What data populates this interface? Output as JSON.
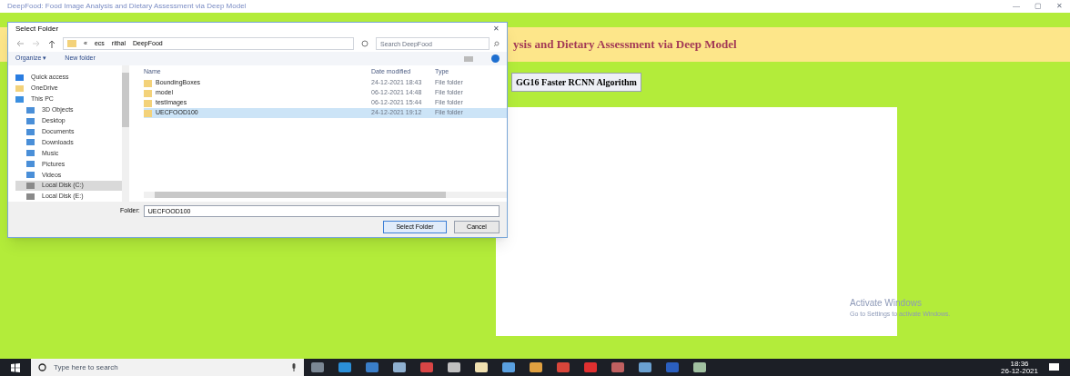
{
  "window": {
    "title": "DeepFood: Food Image Analysis and Dietary Assessment via Deep Model",
    "controls": [
      "—",
      "▢",
      "✕"
    ]
  },
  "app": {
    "heading": "ysis and Dietary Assessment via Deep Model",
    "button": "GG16 Faster RCNN Algorithm"
  },
  "dialog": {
    "title": "Select Folder",
    "close": "✕",
    "path": [
      "«",
      "ecs",
      "rithal",
      "DeepFood"
    ],
    "search": {
      "placeholder": "Search DeepFood"
    },
    "toolbar": [
      "Organize ▾",
      "New folder"
    ],
    "sidebar": [
      {
        "label": "Quick access",
        "selected": false
      },
      {
        "label": "OneDrive",
        "selected": false
      },
      {
        "label": "This PC",
        "selected": false,
        "children": [
          {
            "label": "3D Objects",
            "selected": false
          },
          {
            "label": "Desktop",
            "selected": false
          },
          {
            "label": "Documents",
            "selected": false
          },
          {
            "label": "Downloads",
            "selected": false
          },
          {
            "label": "Music",
            "selected": false
          },
          {
            "label": "Pictures",
            "selected": false
          },
          {
            "label": "Videos",
            "selected": false
          },
          {
            "label": "Local Disk (C:)",
            "selected": true
          },
          {
            "label": "Local Disk (E:)",
            "selected": false
          }
        ]
      }
    ],
    "columns": [
      "Name",
      "Date modified",
      "Type"
    ],
    "rows": [
      {
        "name": "BoundingBoxes",
        "date": "24-12-2021 18:43",
        "type": "File folder",
        "selected": false
      },
      {
        "name": "model",
        "date": "06-12-2021 14:48",
        "type": "File folder",
        "selected": false
      },
      {
        "name": "testImages",
        "date": "06-12-2021 15:44",
        "type": "File folder",
        "selected": false
      },
      {
        "name": "UECFOOD100",
        "date": "24-12-2021 19:12",
        "type": "File folder",
        "selected": true
      }
    ],
    "folder_label": "Folder:",
    "folder_value": "UECFOOD100",
    "buttons": [
      "Select Folder",
      "Cancel"
    ]
  },
  "activation": {
    "title": "Activate Windows",
    "subtitle": "Go to Settings to activate Windows."
  },
  "taskbar": {
    "search": {
      "placeholder": "Type here to search"
    },
    "time": "18:36",
    "date": "26-12-2021"
  }
}
